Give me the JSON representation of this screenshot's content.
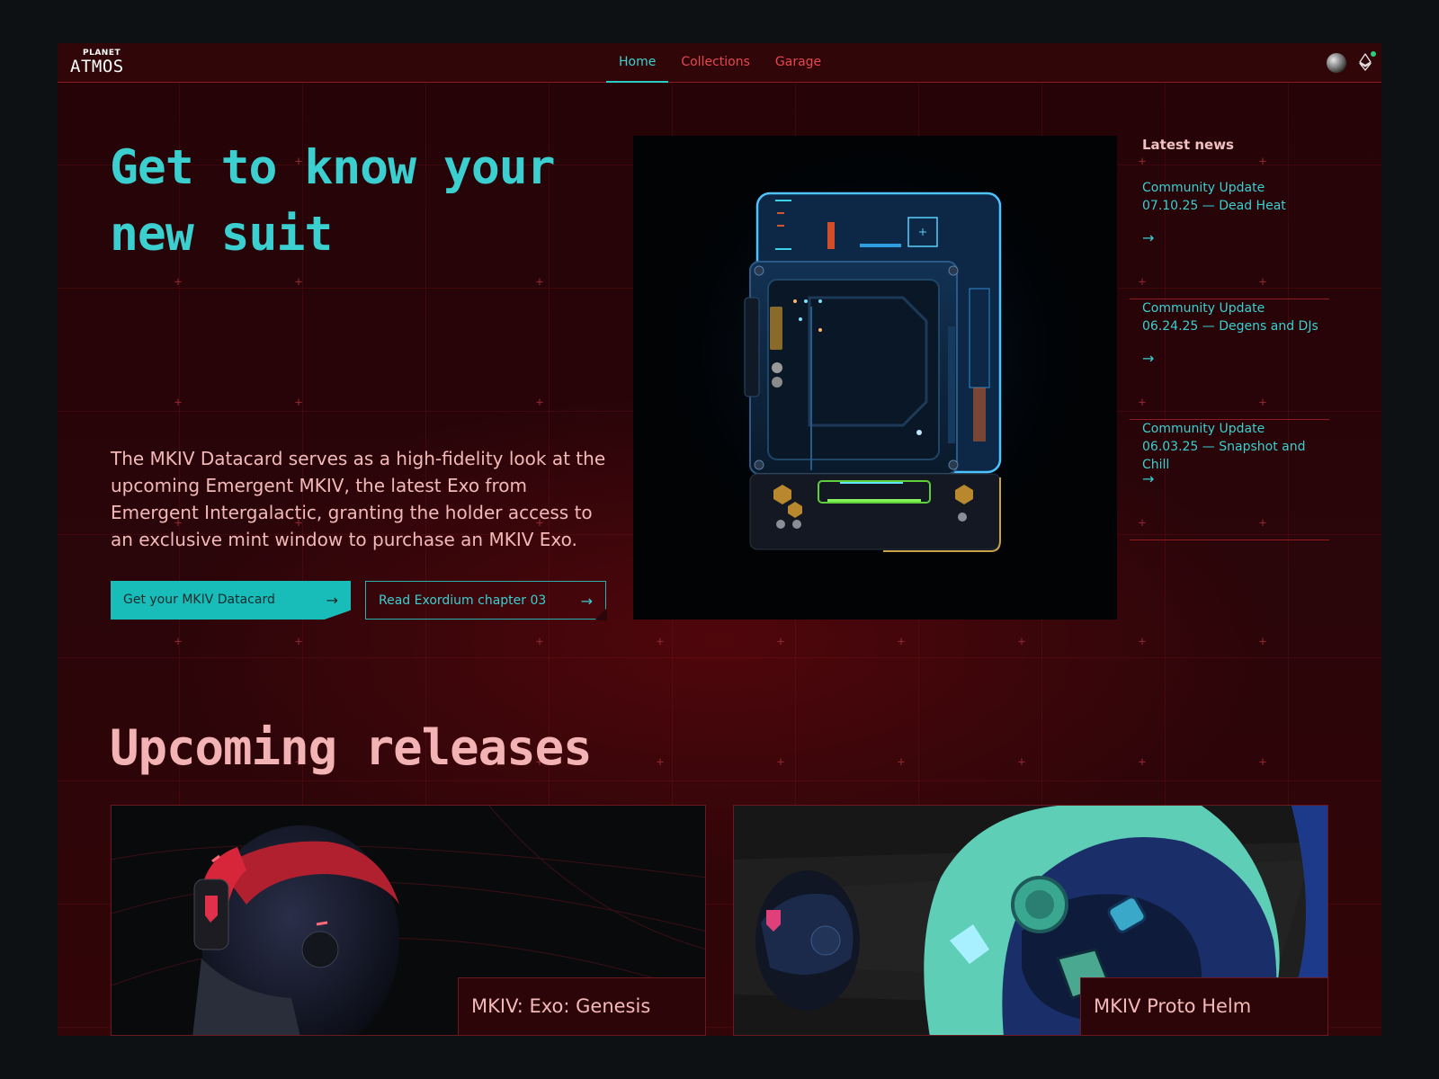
{
  "brand": {
    "top": "PLANET",
    "name": "ATMOS"
  },
  "nav": {
    "items": [
      "Home",
      "Collections",
      "Garage"
    ],
    "active": "Home"
  },
  "header_icons": [
    "globe-icon",
    "ethereum-icon"
  ],
  "hero": {
    "title": "Get to know your new suit",
    "description": "The MKIV Datacard serves as a high-fidelity look at the upcoming Emergent MKIV, the latest Exo from Emergent Intergalactic, granting the holder access to an exclusive mint window to purchase an MKIV Exo.",
    "primary_button": "Get your MKIV Datacard",
    "secondary_button": "Read Exordium chapter 03",
    "arrow": "→"
  },
  "news": {
    "heading": "Latest news",
    "items": [
      {
        "title": "Community Update 07.10.25 — Dead Heat"
      },
      {
        "title": "Community Update 06.24.25 — Degens and DJs"
      },
      {
        "title": "Community Update 06.03.25 — Snapshot and Chill"
      }
    ],
    "arrow": "→"
  },
  "releases": {
    "heading": "Upcoming releases",
    "cards": [
      {
        "label": "MKIV: Exo: Genesis"
      },
      {
        "label": "MKIV Proto Helm"
      }
    ]
  },
  "colors": {
    "accent": "#2ccac7",
    "nav_inactive": "#e5484f",
    "background": "#2a0509",
    "body_text": "#f3b9b9"
  }
}
